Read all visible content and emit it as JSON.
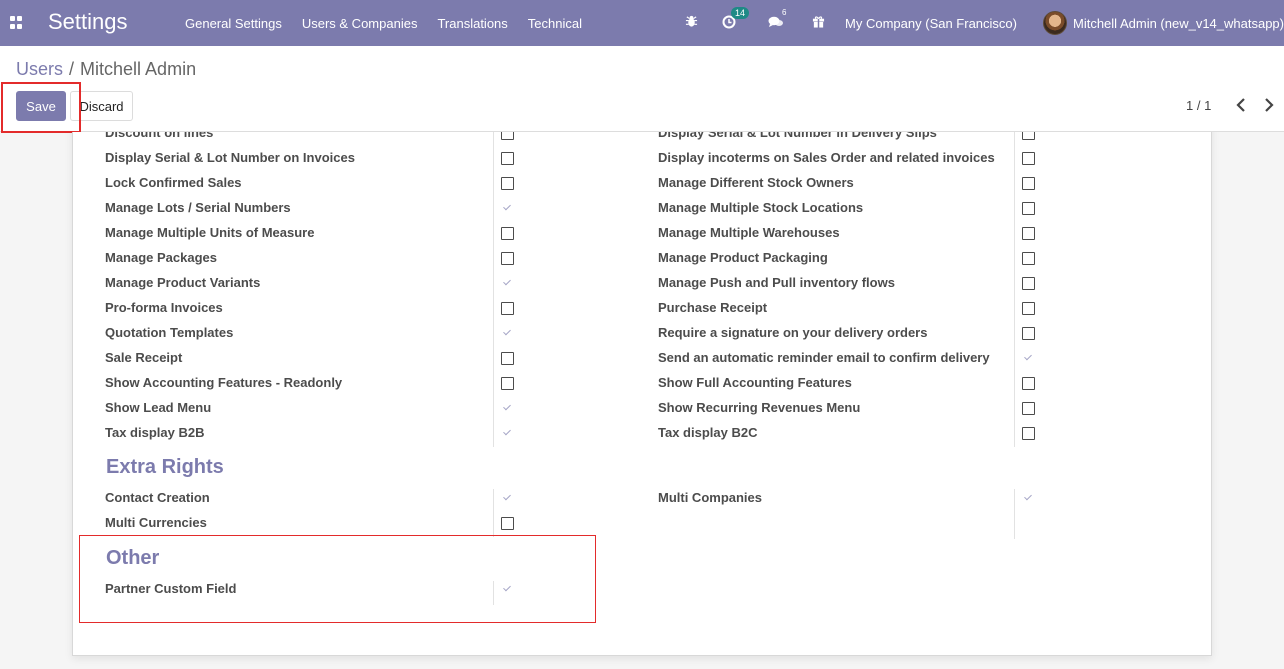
{
  "navbar": {
    "app_name": "Settings",
    "menu": [
      "General Settings",
      "Users & Companies",
      "Translations",
      "Technical"
    ],
    "activity_count": "14",
    "messages_count": "6",
    "company": "My Company (San Francisco)",
    "user": "Mitchell Admin (new_v14_whatsapp)"
  },
  "breadcrumb": {
    "parent": "Users",
    "separator": "/",
    "current": "Mitchell Admin"
  },
  "buttons": {
    "save": "Save",
    "discard": "Discard"
  },
  "pager": {
    "value": "1 / 1"
  },
  "groups_left": [
    {
      "label": "Discount on lines",
      "checked": false
    },
    {
      "label": "Display Serial & Lot Number on Invoices",
      "checked": false
    },
    {
      "label": "Lock Confirmed Sales",
      "checked": false
    },
    {
      "label": "Manage Lots / Serial Numbers",
      "checked": true
    },
    {
      "label": "Manage Multiple Units of Measure",
      "checked": false
    },
    {
      "label": "Manage Packages",
      "checked": false
    },
    {
      "label": "Manage Product Variants",
      "checked": true
    },
    {
      "label": "Pro-forma Invoices",
      "checked": false
    },
    {
      "label": "Quotation Templates",
      "checked": true
    },
    {
      "label": "Sale Receipt",
      "checked": false
    },
    {
      "label": "Show Accounting Features - Readonly",
      "checked": false
    },
    {
      "label": "Show Lead Menu",
      "checked": true
    },
    {
      "label": "Tax display B2B",
      "checked": true
    }
  ],
  "groups_right": [
    {
      "label": "Display Serial & Lot Number in Delivery Slips",
      "checked": false
    },
    {
      "label": "Display incoterms on Sales Order and related invoices",
      "checked": false
    },
    {
      "label": "Manage Different Stock Owners",
      "checked": false
    },
    {
      "label": "Manage Multiple Stock Locations",
      "checked": false
    },
    {
      "label": "Manage Multiple Warehouses",
      "checked": false
    },
    {
      "label": "Manage Product Packaging",
      "checked": false
    },
    {
      "label": "Manage Push and Pull inventory flows",
      "checked": false
    },
    {
      "label": "Purchase Receipt",
      "checked": false
    },
    {
      "label": "Require a signature on your delivery orders",
      "checked": false
    },
    {
      "label": "Send an automatic reminder email to confirm delivery",
      "checked": true
    },
    {
      "label": "Show Full Accounting Features",
      "checked": false
    },
    {
      "label": "Show Recurring Revenues Menu",
      "checked": false
    },
    {
      "label": "Tax display B2C",
      "checked": false
    }
  ],
  "extra_rights": {
    "title": "Extra Rights",
    "left": [
      {
        "label": "Contact Creation",
        "checked": true
      },
      {
        "label": "Multi Currencies",
        "checked": false
      }
    ],
    "right": [
      {
        "label": "Multi Companies",
        "checked": true
      }
    ]
  },
  "other": {
    "title": "Other",
    "items": [
      {
        "label": "Partner Custom Field",
        "checked": true
      }
    ]
  },
  "colors": {
    "brand": "#7c7bad",
    "highlight": "#e32b2b"
  },
  "icons": [
    "apps-grid-icon",
    "bug-icon",
    "activity-clock-icon",
    "messages-icon",
    "gift-icon",
    "chevron-left-icon",
    "chevron-right-icon"
  ]
}
